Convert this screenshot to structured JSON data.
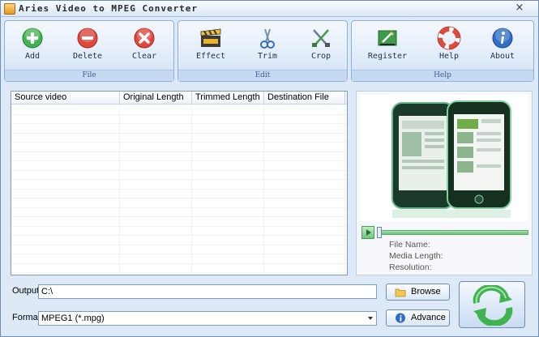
{
  "window": {
    "title": "Aries Video to MPEG Converter",
    "close_glyph": "×"
  },
  "toolbar": {
    "groups": [
      {
        "title": "File",
        "buttons": [
          {
            "label": "Add",
            "icon": "add-icon"
          },
          {
            "label": "Delete",
            "icon": "delete-icon"
          },
          {
            "label": "Clear",
            "icon": "clear-icon"
          }
        ]
      },
      {
        "title": "Edit",
        "buttons": [
          {
            "label": "Effect",
            "icon": "film-clapper-icon"
          },
          {
            "label": "Trim",
            "icon": "scissors-icon"
          },
          {
            "label": "Crop",
            "icon": "crop-tools-icon"
          }
        ]
      },
      {
        "title": "Help",
        "buttons": [
          {
            "label": "Register",
            "icon": "register-icon"
          },
          {
            "label": "Help",
            "icon": "lifebuoy-icon"
          },
          {
            "label": "About",
            "icon": "info-icon"
          }
        ]
      }
    ]
  },
  "file_list": {
    "columns": [
      "Source video",
      "Original Length",
      "Trimmed Length",
      "Destination File"
    ],
    "rows": []
  },
  "preview": {
    "file_name_label": "File Name:",
    "media_length_label": "Media Length:",
    "resolution_label": "Resolution:"
  },
  "output": {
    "label": "Output:",
    "value": "C:\\",
    "browse_label": "Browse"
  },
  "format": {
    "label": "Format:",
    "value": "MPEG1 (*.mpg)",
    "advance_label": "Advance"
  },
  "colors": {
    "accent_green": "#3fb34f",
    "toolbar_blue": "#c5d9f1",
    "border_blue": "#7f9db9"
  }
}
